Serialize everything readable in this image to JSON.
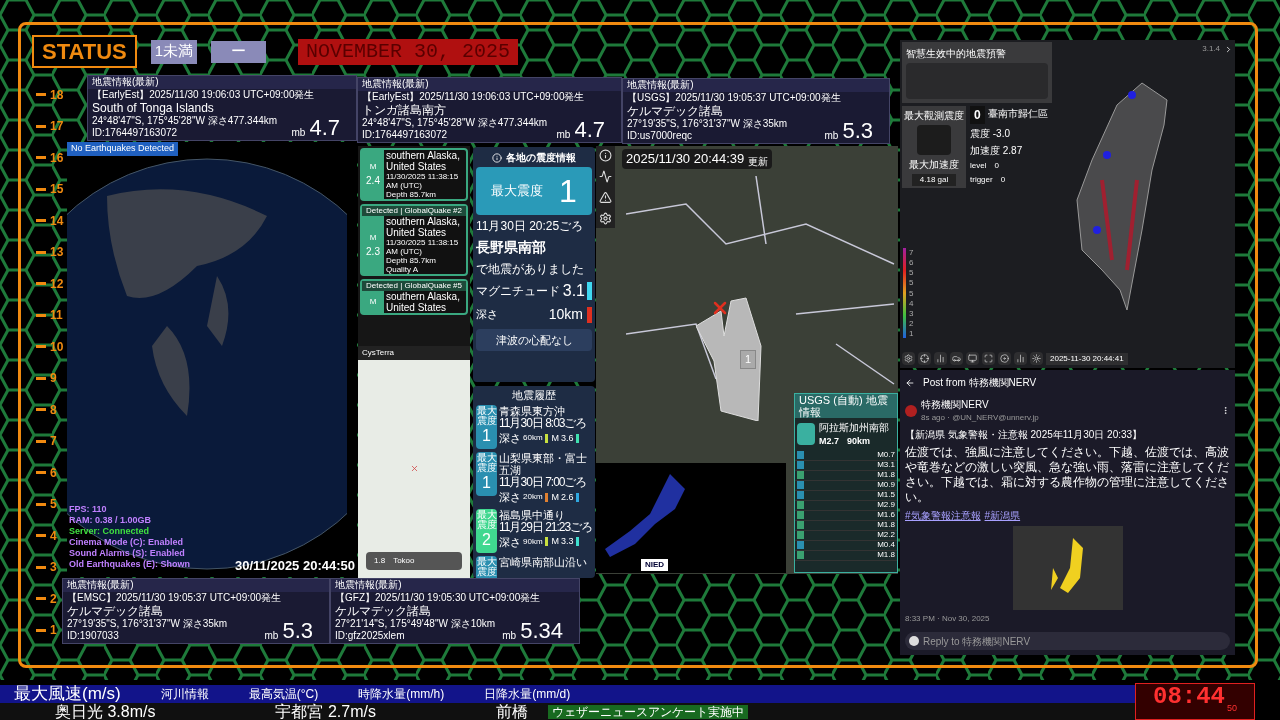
{
  "status": {
    "label": "STATUS",
    "badge_1": "1未満",
    "badge_2": "ー",
    "date": "NOVEMBER 30, 2025"
  },
  "scale": [
    "18",
    "17",
    "16",
    "15",
    "14",
    "13",
    "12",
    "11",
    "10",
    "9",
    "8",
    "7",
    "6",
    "5",
    "4",
    "3",
    "2",
    "1"
  ],
  "quake_cards": [
    {
      "header": "地震情報(最新)",
      "source": "【EarlyEst】2025/11/30  19:06:03  UTC+09:00発生",
      "place": "South of Tonga Islands",
      "coords": "24°48'47\"S,  175°45'28\"W   深さ477.344km",
      "id": "ID:1764497163072",
      "mag_type": "mb",
      "mag": "4.7"
    },
    {
      "header": "地震情報(最新)",
      "source": "【EarlyEst】2025/11/30  19:06:03  UTC+09:00発生",
      "place": "トンガ諸島南方",
      "coords": "24°48'47\"S,  175°45'28\"W   深さ477.344km",
      "id": "ID:1764497163072",
      "mag_type": "mb",
      "mag": "4.7"
    },
    {
      "header": "地震情報(最新)",
      "source": "【USGS】2025/11/30  19:05:37  UTC+09:00発生",
      "place": "ケルマデック諸島",
      "coords": "27°19'35\"S,  176°31'37\"W   深さ35km",
      "id": "ID:us7000reqc",
      "mag_type": "mb",
      "mag": "5.3"
    },
    {
      "header": "地震情報(最新)",
      "source": "【EMSC】2025/11/30  19:05:37  UTC+09:00発生",
      "place": "ケルマデック諸島",
      "coords": "27°19'35\"S,  176°31'37\"W   深さ35km",
      "id": "ID:1907033",
      "mag_type": "mb",
      "mag": "5.3"
    },
    {
      "header": "地震情報(最新)",
      "source": "【GFZ】2025/11/30  19:05:30  UTC+09:00発生",
      "place": "ケルマデック諸島",
      "coords": "27°21'14\"S,  175°49'48\"W   深さ10km",
      "id": "ID:gfz2025xlem",
      "mag_type": "mb",
      "mag": "5.34"
    }
  ],
  "globe": {
    "banner": "No Earthquakes Detected",
    "timestamp": "30/11/2025 20:44:50",
    "stats": [
      {
        "text": "FPS: 110",
        "color": "#c080ff"
      },
      {
        "text": "RAM: 0.38 / 1.00GB",
        "color": "#c080ff"
      },
      {
        "text": "Server: Connected",
        "color": "#40e040"
      },
      {
        "text": "Cinema Mode (C): Enabled",
        "color": "#c080ff"
      },
      {
        "text": "Sound Alarms (S): Enabled",
        "color": "#c080ff"
      },
      {
        "text": "Old Earthquakes (E): Shown",
        "color": "#c080ff"
      }
    ]
  },
  "globalquake": [
    {
      "mag_label": "M",
      "mag": "2.4",
      "region": "southern Alaska, United States",
      "time": "11/30/2025 11:38:15 AM (UTC)",
      "depth": "Depth 85.7km"
    },
    {
      "detected": "Detected | GlobalQuake",
      "number": "#2",
      "mag_label": "M",
      "mag": "2.3",
      "region": "southern Alaska, United States",
      "time": "11/30/2025 11:38:15 AM (UTC)",
      "depth": "Depth 85.7km",
      "quality": "Quality A"
    },
    {
      "detected": "Detected | GlobalQuake",
      "number": "#5",
      "mag_label": "M",
      "region": "southern Alaska, United States"
    }
  ],
  "cysterra": {
    "title": "CysTerra",
    "mag": "1.8",
    "place": "Tokoo"
  },
  "intensity": {
    "title": "各地の震度情報",
    "max_label": "最大震度",
    "max_value": "1",
    "time": "11月30日 20:25ごろ",
    "place": "長野県南部",
    "sentence": "で地震がありました",
    "magnitude": {
      "label": "マグニチュード",
      "value": "3.1",
      "color": "#40d8f0"
    },
    "depth": {
      "label": "深さ",
      "value": "10km",
      "color": "#e03020"
    },
    "tsunami": "津波の心配なし"
  },
  "history": {
    "title": "地震履歴",
    "items": [
      {
        "label": "最大震度",
        "intensity": "1",
        "color": "#2a8fb0",
        "place": "青森県東方沖",
        "time": "11月30日 8:03ごろ",
        "depth": {
          "label": "深さ",
          "value": "60km",
          "color": "#c8e040"
        },
        "magnitude": {
          "label": "M",
          "value": "3.6",
          "color": "#40e0b0"
        }
      },
      {
        "label": "最大震度",
        "intensity": "1",
        "color": "#2a8fb0",
        "place": "山梨県東部・富士五湖",
        "time": "11月30日 7:00ごろ",
        "depth": {
          "label": "深さ",
          "value": "20km",
          "color": "#e08030"
        },
        "magnitude": {
          "label": "M",
          "value": "2.6",
          "color": "#30a8e0"
        }
      },
      {
        "label": "最大震度",
        "intensity": "2",
        "color": "#40d890",
        "place": "福島県中通り",
        "time": "11月29日 21:23ごろ",
        "depth": {
          "label": "深さ",
          "value": "90km",
          "color": "#c8e040"
        },
        "magnitude": {
          "label": "M",
          "value": "3.3",
          "color": "#40e0d0"
        }
      },
      {
        "label": "最大震度",
        "color": "#2a8fb0",
        "place": "宮崎県南部山沿い"
      }
    ]
  },
  "map": {
    "timestamp": "2025/11/30 20:44:39",
    "updated": "更新",
    "intensity": "1"
  },
  "usgs": {
    "title": "USGS (自動) 地震情報",
    "place": "阿拉斯加州南部",
    "mag": "M2.7",
    "depth": "90km",
    "items": [
      {
        "color": "#2a8fb0",
        "mag": "M0.7"
      },
      {
        "color": "#2a8fb0",
        "mag": "M3.1"
      },
      {
        "color": "#3aa070",
        "mag": "M1.8"
      },
      {
        "color": "#2a8fb0",
        "mag": "M0.9"
      },
      {
        "color": "#2a8fb0",
        "mag": "M1.5"
      },
      {
        "color": "#3aa070",
        "mag": "M2.9"
      },
      {
        "color": "#3aa070",
        "mag": "M1.6"
      },
      {
        "color": "#3aa070",
        "mag": "M1.8"
      },
      {
        "color": "#3aa070",
        "mag": "M2.2"
      },
      {
        "color": "#2a8fb0",
        "mag": "M0.4"
      },
      {
        "color": "#3aa070",
        "mag": "M1.8"
      }
    ]
  },
  "nied": {
    "logo": "NIED"
  },
  "taiwan": {
    "title": "智慧生效中的地震預警",
    "max_label": "最大觀測震度",
    "intensity": "0",
    "station": "臺南市歸仁區",
    "reading_1": "震度 -3.0",
    "reading_2": "加速度 2.87",
    "level_label": "level",
    "level_value": "0",
    "trigger_label": "trigger",
    "trigger_value": "0",
    "accel_label": "最大加速度",
    "accel": "4.18 gal",
    "version": "3.1.4",
    "legend": [
      "7",
      "6",
      "5",
      "5",
      "5",
      "4",
      "3",
      "2",
      "1"
    ],
    "timestamp": "2025-11-30 20:44:41"
  },
  "post": {
    "header": "Post from 特務機関NERV",
    "author": "特務機関NERV",
    "handle": "8s ago · @UN_NERV@unnerv.jp",
    "title": "【新潟県 気象警報・注意報 2025年11月30日 20:33】",
    "body": "佐渡では、強風に注意してください。下越、佐渡では、高波や竜巻などの激しい突風、急な強い雨、落雷に注意してください。下越では、霜に対する農作物の管理に注意してください。",
    "tags": [
      "#気象警報注意報",
      "#新潟県"
    ],
    "time": "8:33 PM · Nov 30, 2025",
    "reply_placeholder": "Reply to 特務機関NERV"
  },
  "ticker": {
    "headings": [
      "最大風速(m/s)",
      "河川情報",
      "最高気温(°C)",
      "時降水量(mm/h)",
      "日降水量(mm/d)"
    ],
    "values": [
      "奥日光  3.8m/s",
      "宇都宮  2.7m/s",
      "前橋"
    ],
    "banner": "ウェザーニュースアンケート実施中"
  },
  "clock": {
    "time": "08:44",
    "seconds": "50"
  }
}
